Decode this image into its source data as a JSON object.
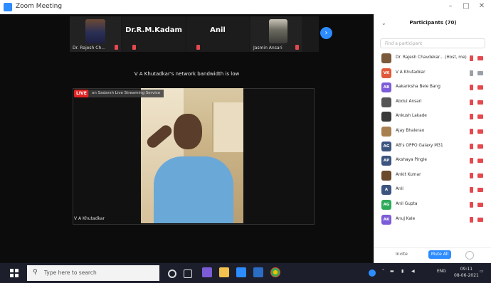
{
  "window": {
    "title": "Zoom Meeting"
  },
  "strip": {
    "thumbs": [
      {
        "name": "Dr. Rajesh Ch..."
      },
      {
        "name": "Dr.R.M.Kadam"
      },
      {
        "name": "Anil"
      },
      {
        "name": "Jasmin Ansari"
      }
    ]
  },
  "notice": "V A Khutadkar's network bandwidth is low",
  "main_video": {
    "live_badge": "LIVE",
    "live_text": "on Sadarsh Live Streaming Service",
    "speaker": "V A Khutadkar"
  },
  "participants": {
    "header": "Participants (70)",
    "search_placeholder": "Find a participant",
    "list": [
      {
        "name": "Dr. Rajesh Chavdekar... (Host, me)",
        "initials": "",
        "color": "#7a5a3a",
        "mic_on": false,
        "cam_on": false
      },
      {
        "name": "V A Khutadkar",
        "initials": "VK",
        "color": "#e05a3a",
        "mic_on": true,
        "cam_on": true
      },
      {
        "name": "Aakanksha Bele Bang",
        "initials": "AB",
        "color": "#7c5cd8",
        "mic_on": false,
        "cam_on": false
      },
      {
        "name": "Abdul Ansari",
        "initials": "",
        "color": "#555",
        "mic_on": false,
        "cam_on": false
      },
      {
        "name": "Ankush Lakade",
        "initials": "",
        "color": "#3a3a3a",
        "mic_on": false,
        "cam_on": false
      },
      {
        "name": "Ajay Bhalerao",
        "initials": "",
        "color": "#a88050",
        "mic_on": false,
        "cam_on": false
      },
      {
        "name": "AB's OPPO Galaxy M31",
        "initials": "AG",
        "color": "#3c5580",
        "mic_on": false,
        "cam_on": false
      },
      {
        "name": "Akshaya Pingle",
        "initials": "AP",
        "color": "#3c5580",
        "mic_on": false,
        "cam_on": false
      },
      {
        "name": "Ankit Kumar",
        "initials": "",
        "color": "#6a4a2a",
        "mic_on": false,
        "cam_on": false
      },
      {
        "name": "Anil",
        "initials": "A",
        "color": "#3c5580",
        "mic_on": false,
        "cam_on": false
      },
      {
        "name": "Anil Gupta",
        "initials": "AG",
        "color": "#2eaa5a",
        "mic_on": false,
        "cam_on": false
      },
      {
        "name": "Anuj Kale",
        "initials": "AK",
        "color": "#7c5cd8",
        "mic_on": false,
        "cam_on": false
      }
    ],
    "invite": "Invite",
    "mute_all": "Mute All"
  },
  "taskbar": {
    "search_placeholder": "Type here to search",
    "lang": "ENG",
    "time": "09:11",
    "date": "08-06-2021"
  },
  "colors": {
    "accent": "#2d8cff",
    "live": "#e02424",
    "taskbar": "#1c1f2b"
  }
}
